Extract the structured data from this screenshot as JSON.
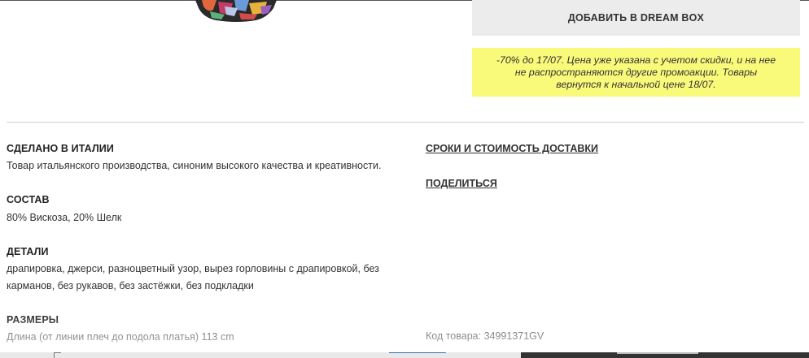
{
  "actions": {
    "dreambox_button_label": "ДОБАВИТЬ В DREAM BOX"
  },
  "promo": {
    "text": "-70% до 17/07. Цена уже указана с учетом скидки, и на нее не распространяются другие промоакции. Товары вернутся к начальной цене 18/07."
  },
  "details": {
    "made_in_title": "СДЕЛАНО В ИТАЛИИ",
    "made_in_text": "Товар итальянского производства, синоним высокого качества и креативности.",
    "composition_title": "СОСТАВ",
    "composition_text": "80% Вискоза, 20% Шелк",
    "details_title": "ДЕТАЛИ",
    "details_text": "драпировка, джерси, разноцветный узор, вырез горловины с драпировкой, без карманов, без рукавов, без застёжки, без подкладки",
    "sizes_title": "РАЗМЕРЫ",
    "sizes_text": "Длина (от линии плеч до подола платья) 113 cm"
  },
  "side": {
    "delivery_link": "СРОКИ И СТОИМОСТЬ ДОСТАВКИ",
    "share_link": "ПОДЕЛИТЬСЯ",
    "sku_text": "Код товара: 34991371GV"
  },
  "colors": {
    "promo_bg": "#f9f97a",
    "button_bg": "#ececec"
  }
}
